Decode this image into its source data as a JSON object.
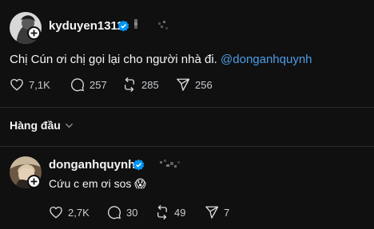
{
  "post": {
    "username": "kyduyen1311",
    "text": "Chị Cún ơi chị gọi lại cho người nhà đi.",
    "mention": "@donganhquynh",
    "likes": "7,1K",
    "comments": "257",
    "reposts": "285",
    "shares": "256"
  },
  "sort": {
    "label": "Hàng đầu"
  },
  "reply": {
    "username": "donganhquynh",
    "text": "Cứu c em ơi sos 😱",
    "likes": "2,7K",
    "comments": "30",
    "reposts": "49",
    "shares": "7"
  },
  "colors": {
    "background": "#101010",
    "text": "#f3f5f7",
    "muted": "#c9ccd1",
    "mention": "#4c9ce6",
    "verified": "#0095f6",
    "divider": "#2a2a2a"
  }
}
